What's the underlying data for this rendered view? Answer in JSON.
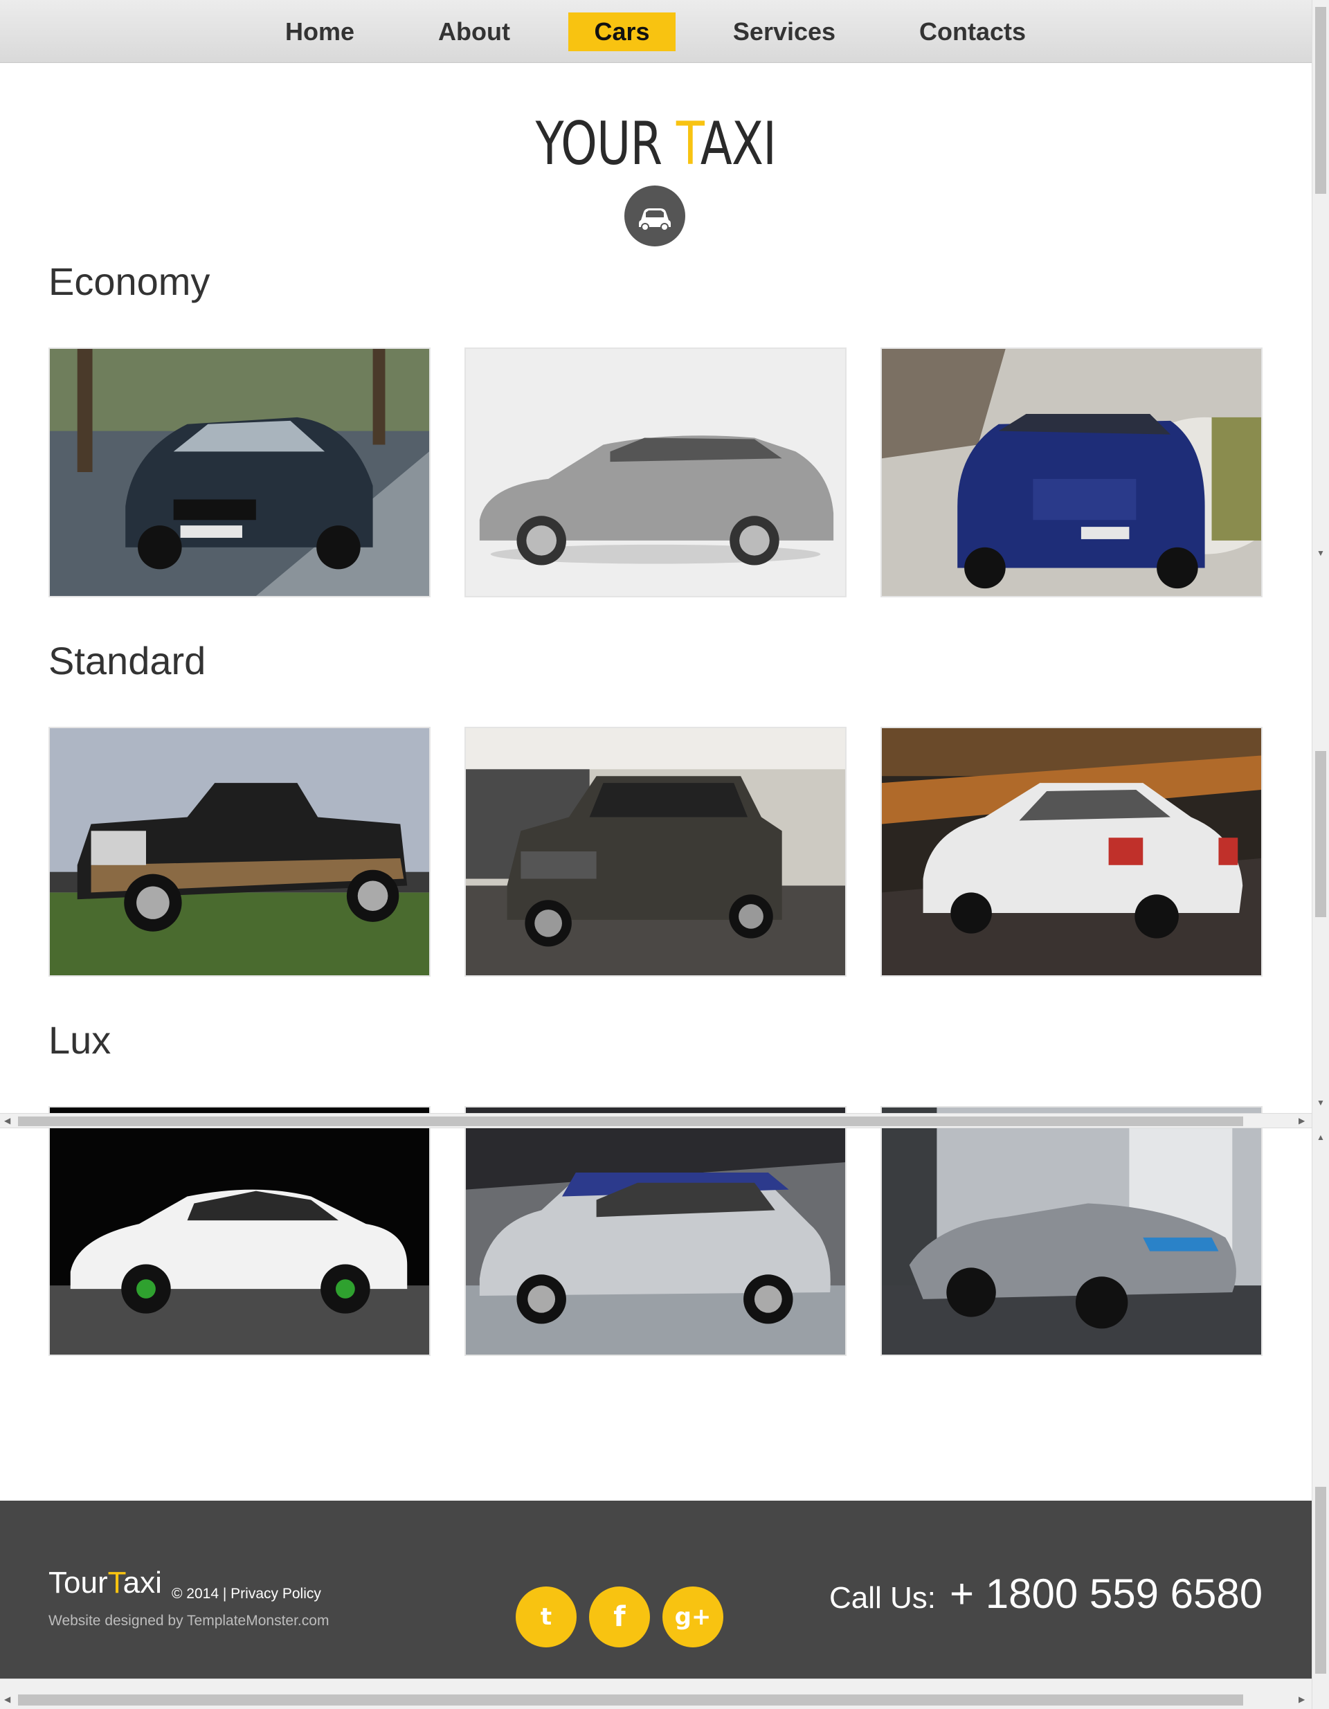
{
  "nav": {
    "items": [
      {
        "label": "Home"
      },
      {
        "label": "About"
      },
      {
        "label": "Cars",
        "active": true
      },
      {
        "label": "Services"
      },
      {
        "label": "Contacts"
      }
    ]
  },
  "logo": {
    "part1": "YOUR ",
    "accent": "T",
    "part2": "AXI",
    "icon": "car-icon"
  },
  "sections": [
    {
      "title": "Economy"
    },
    {
      "title": "Standard"
    },
    {
      "title": "Lux"
    }
  ],
  "footer": {
    "brand_part1": "Tour",
    "brand_accent": "T",
    "brand_part2": "axi",
    "copyright": "© 2014 |",
    "privacy": "Privacy Policy",
    "designed_by": "Website designed by TemplateMonster.com",
    "social": [
      {
        "icon": "twitter-icon",
        "glyph": "t"
      },
      {
        "icon": "facebook-icon",
        "glyph": "f"
      },
      {
        "icon": "google-plus-icon",
        "glyph": "g+"
      }
    ],
    "call_label": "Call Us:",
    "phone": "+ 1800 559 6580"
  },
  "colors": {
    "accent": "#f8c311",
    "footer": "#474747",
    "nav": "#e0e0e0"
  }
}
